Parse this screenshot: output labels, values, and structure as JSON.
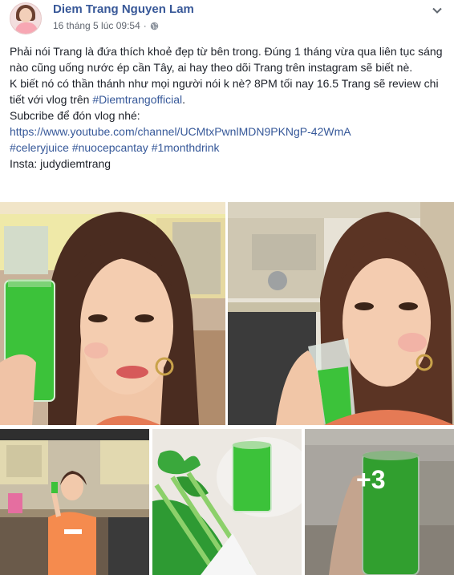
{
  "post": {
    "author_name": "Diem Trang Nguyen Lam",
    "timestamp": "16 tháng 5 lúc 09:54",
    "privacy_icon": "globe-icon",
    "options_icon": "chevron-down-icon",
    "lines": {
      "p1": "Phải nói Trang là đứa thích khoẻ đẹp từ bên trong. Đúng 1 tháng vừa qua liên tục sáng nào cũng uống nước ép cần Tây, ai hay theo dõi Trang trên instagram sẽ biết nè.",
      "p2a": "K biết nó có thần thánh như mọi người nói k nè? 8PM tối nay 16.5 Trang sẽ review chi tiết với vlog trên ",
      "p2_tag": "#Diemtrangofficial",
      "p2b": ".",
      "p3": "Subcribe để đón vlog nhé:",
      "youtube_link": "https://www.youtube.com/channel/UCMtxPwnlMDN9PKNgP-42WmA",
      "hashtag1": "#celeryjuice",
      "hashtag2": "#nuocepcantay",
      "hashtag3": "#1monthdrink",
      "insta": "Insta: judydiemtrang"
    },
    "more_photos_label": "+3"
  },
  "colors": {
    "link": "#365899",
    "author": "#385898",
    "juice": "#3cc23a"
  }
}
